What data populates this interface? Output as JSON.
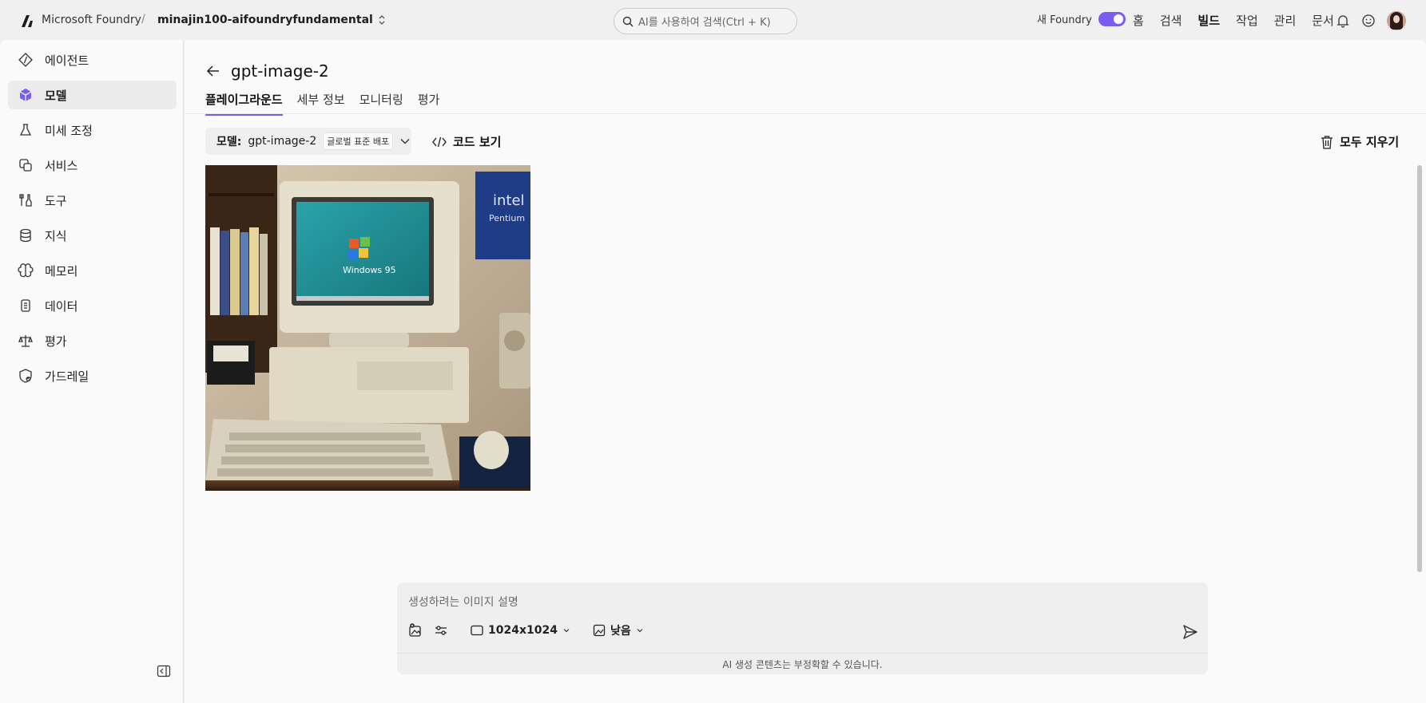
{
  "topbar": {
    "brand": "Microsoft Foundry",
    "separator": "/",
    "project": "minajin100-aifoundryfundamental",
    "search_placeholder": "AI를 사용하여 검색(Ctrl + K)",
    "new_foundry_label": "새 Foundry",
    "new_foundry_enabled": true,
    "nav": [
      "홈",
      "검색",
      "빌드",
      "작업",
      "관리",
      "문서"
    ],
    "nav_active": "빌드"
  },
  "sidebar": {
    "items": [
      {
        "label": "에이전트",
        "icon": "agent-icon"
      },
      {
        "label": "모델",
        "icon": "model-cube-icon",
        "active": true
      },
      {
        "label": "미세 조정",
        "icon": "flask-icon"
      },
      {
        "label": "서비스",
        "icon": "services-icon"
      },
      {
        "label": "도구",
        "icon": "tools-icon"
      },
      {
        "label": "지식",
        "icon": "database-icon"
      },
      {
        "label": "메모리",
        "icon": "brain-icon"
      },
      {
        "label": "데이터",
        "icon": "data-icon"
      },
      {
        "label": "평가",
        "icon": "scale-icon"
      },
      {
        "label": "가드레일",
        "icon": "shield-icon"
      }
    ]
  },
  "main": {
    "title": "gpt-image-2",
    "tabs": [
      "플레이그라운드",
      "세부 정보",
      "모니터링",
      "평가"
    ],
    "active_tab": "플레이그라운드",
    "model_select": {
      "label": "모델:",
      "value": "gpt-image-2",
      "deployment_badge": "글로벌 표준 배포"
    },
    "code_button": "코드 보기",
    "clear_button": "모두 지우기",
    "generated_image_alt": "Retro Windows 95 PC on a desk"
  },
  "composer": {
    "placeholder": "생성하려는 이미지 설명",
    "size": "1024x1024",
    "quality": "낮음",
    "disclaimer": "AI 생성 콘텐츠는 부정확할 수 있습니다."
  },
  "colors": {
    "accent": "#7b5cf0",
    "background": "#f0f0f0",
    "panel": "#fafafa"
  }
}
